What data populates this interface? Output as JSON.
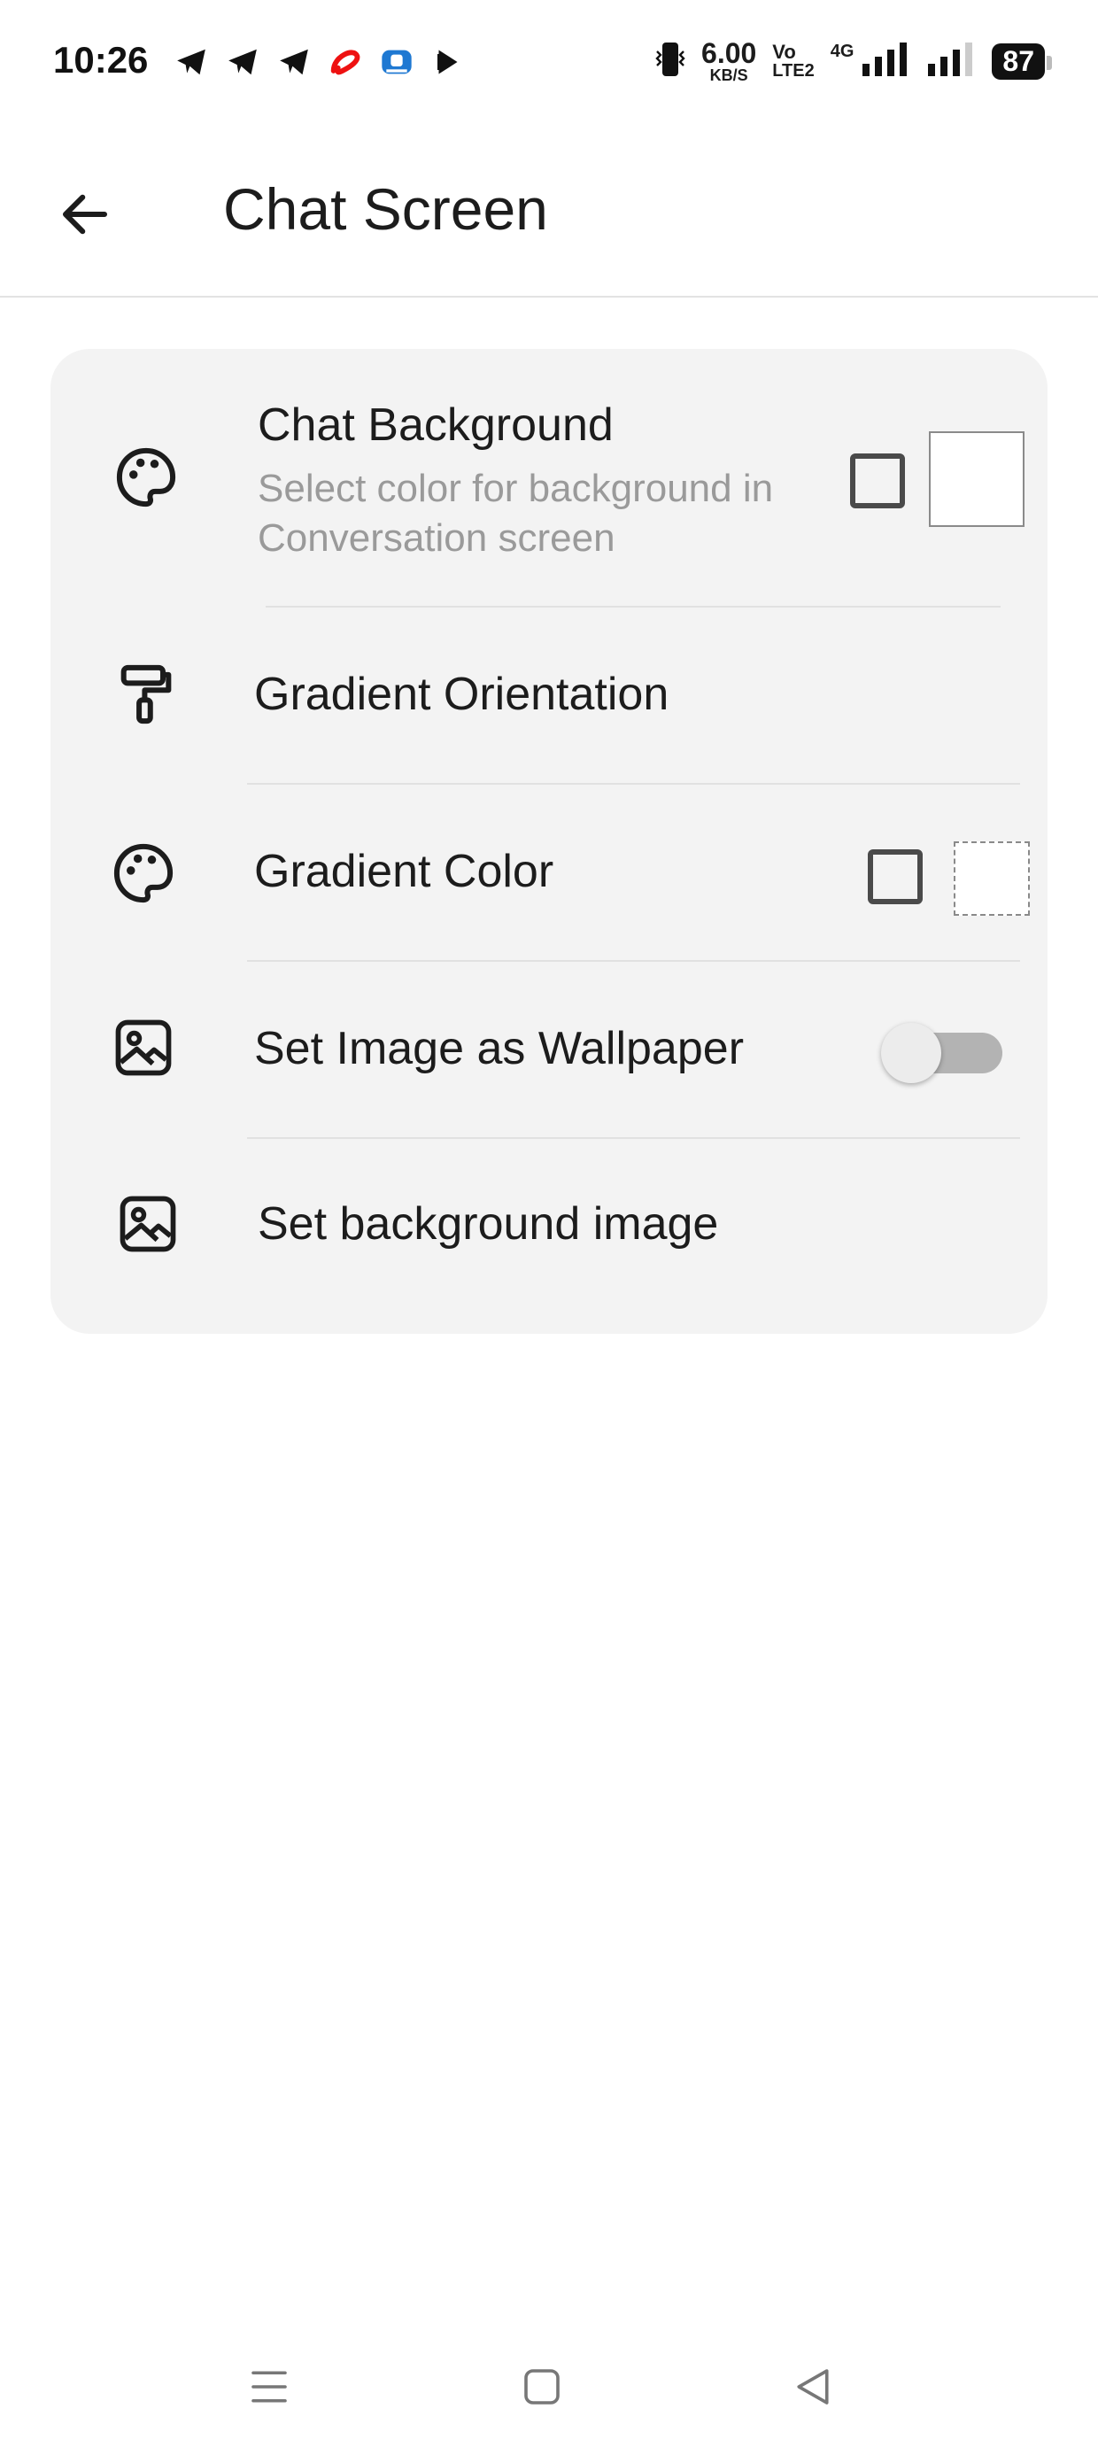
{
  "status_bar": {
    "time": "10:26",
    "speed_value": "6.00",
    "speed_unit": "KB/S",
    "volte_top": "Vo",
    "volte_bottom": "LTE2",
    "network_type": "4G",
    "battery": "87",
    "left_icons": [
      "telegram-icon",
      "telegram-icon",
      "telegram-icon",
      "airtel-icon",
      "app-icon",
      "play-icon"
    ]
  },
  "header": {
    "title": "Chat Screen",
    "back_icon": "arrow-left-icon"
  },
  "settings": {
    "chat_background": {
      "title": "Chat Background",
      "subtitle_line1": "Select color for background in",
      "subtitle_line2": "Conversation screen",
      "icon": "palette-icon",
      "checked": false,
      "swatch_color": "#ffffff"
    },
    "gradient_orientation": {
      "title": "Gradient Orientation",
      "icon": "paint-roller-icon"
    },
    "gradient_color": {
      "title": "Gradient Color",
      "icon": "palette-icon",
      "checked": false,
      "swatch_color": "#ffffff"
    },
    "image_wallpaper": {
      "title": "Set Image as Wallpaper",
      "icon": "image-icon",
      "enabled": false
    },
    "background_image": {
      "title": "Set background image",
      "icon": "image-icon"
    }
  },
  "colors": {
    "card_bg": "#f3f3f3",
    "subtitle": "#9a9a9a",
    "toggle_track": "#b3b3b3"
  },
  "nav_bar": {
    "icons": [
      "menu-icon",
      "home-square-icon",
      "back-triangle-icon"
    ]
  }
}
